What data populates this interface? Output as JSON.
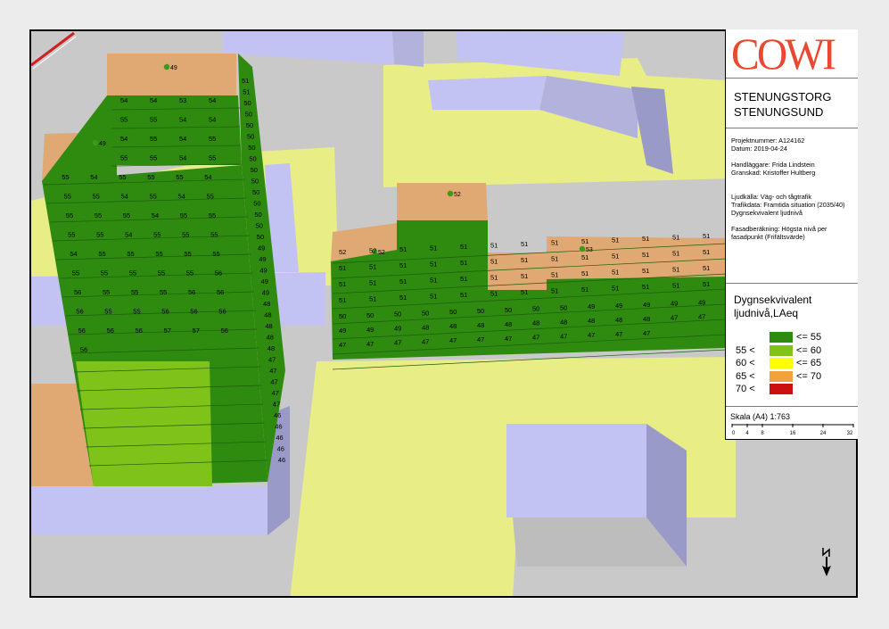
{
  "logo_text": "COWI",
  "project": {
    "title_lines": [
      "STENUNGSTORG",
      "STENUNGSUND"
    ],
    "number": "Projektnummer: A124162",
    "date": "Datum: 2019-04-24",
    "handler": "Handläggare: Frida Lindstein",
    "reviewer": "Granskad: Kristoffer Hultberg",
    "source": "Ljudkälla: Väg- och tågtrafik",
    "traffic": "Trafikdata: Framtida situation (2035/40)",
    "metric": "Dygnsekvivalent ljudnivå",
    "calc_line1": "Fasadberäkning: Högsta nivå per",
    "calc_line2": "fasadpunkt (Frifältsvärde)"
  },
  "legend": {
    "title_line1": "Dygnsekvivalent",
    "title_line2": "ljudnivå,LAeq",
    "classes": [
      {
        "low": "",
        "high": "<= 55",
        "color": "#2f8a10"
      },
      {
        "low": "55 <",
        "high": "<= 60",
        "color": "#7fc21a"
      },
      {
        "low": "60 <",
        "high": "<= 65",
        "color": "#ffff00"
      },
      {
        "low": "65 <",
        "high": "<= 70",
        "color": "#f2a23c"
      },
      {
        "low": "70 <",
        "high": "",
        "color": "#cc1010"
      }
    ]
  },
  "scale": {
    "label": "Skala (A4) 1:763",
    "ticks": [
      "0",
      "4",
      "8",
      "16",
      "24",
      "32"
    ]
  },
  "colors": {
    "ground": "#c9c9c9",
    "terrain": "#e8ed86",
    "walls": "#c2c3f2",
    "roof": "#e0a873",
    "facade_green": "#2f8a10",
    "facade_lightgreen": "#7fc21a"
  },
  "facade_levels": {
    "tower_front": [
      "54",
      "54",
      "53",
      "54",
      "55",
      "55",
      "54",
      "54",
      "54",
      "55",
      "54",
      "55",
      "55",
      "55",
      "54",
      "55",
      "55",
      "54",
      "55",
      "55",
      "55",
      "54",
      "55",
      "55",
      "54",
      "55",
      "54",
      "55",
      "55",
      "55",
      "55",
      "54",
      "55",
      "55",
      "55",
      "55",
      "54",
      "55",
      "55",
      "55",
      "54",
      "55",
      "55",
      "55",
      "55",
      "55",
      "55",
      "55",
      "55",
      "55",
      "55",
      "56",
      "56",
      "55",
      "55",
      "55",
      "56",
      "56",
      "56",
      "55",
      "55",
      "56",
      "56",
      "56",
      "56",
      "56",
      "56",
      "57",
      "57",
      "56",
      "56"
    ],
    "tower_side": [
      "51",
      "51",
      "50",
      "50",
      "50",
      "50",
      "50",
      "50",
      "50",
      "50",
      "50",
      "50",
      "50",
      "50",
      "50",
      "49",
      "49",
      "49",
      "49",
      "49",
      "48",
      "48",
      "48",
      "48",
      "48",
      "47",
      "47",
      "47",
      "47",
      "47",
      "46",
      "46",
      "46",
      "46",
      "46"
    ],
    "low_block": [
      "52",
      "52",
      "51",
      "51",
      "51",
      "51",
      "51",
      "51",
      "51",
      "51",
      "51",
      "51",
      "51",
      "51",
      "51",
      "51",
      "51",
      "51",
      "51",
      "51",
      "51",
      "51",
      "51",
      "51",
      "51",
      "51",
      "51",
      "51",
      "51",
      "51",
      "51",
      "51",
      "51",
      "51",
      "51",
      "51",
      "51",
      "51",
      "51",
      "51",
      "51",
      "51",
      "51",
      "51",
      "51",
      "51",
      "51",
      "51",
      "51",
      "51",
      "51",
      "51"
    ],
    "low_block2": [
      "50",
      "50",
      "50",
      "50",
      "50",
      "50",
      "50",
      "50",
      "50",
      "49",
      "49",
      "49",
      "49",
      "49",
      "49",
      "49",
      "49",
      "48",
      "48",
      "48",
      "48",
      "48",
      "48",
      "48",
      "48",
      "48",
      "47",
      "47",
      "47",
      "47",
      "47",
      "47",
      "47",
      "47",
      "47",
      "47",
      "47",
      "47",
      "47",
      "47"
    ],
    "roof_points": [
      "49",
      "49",
      "52",
      "52",
      "53"
    ]
  }
}
